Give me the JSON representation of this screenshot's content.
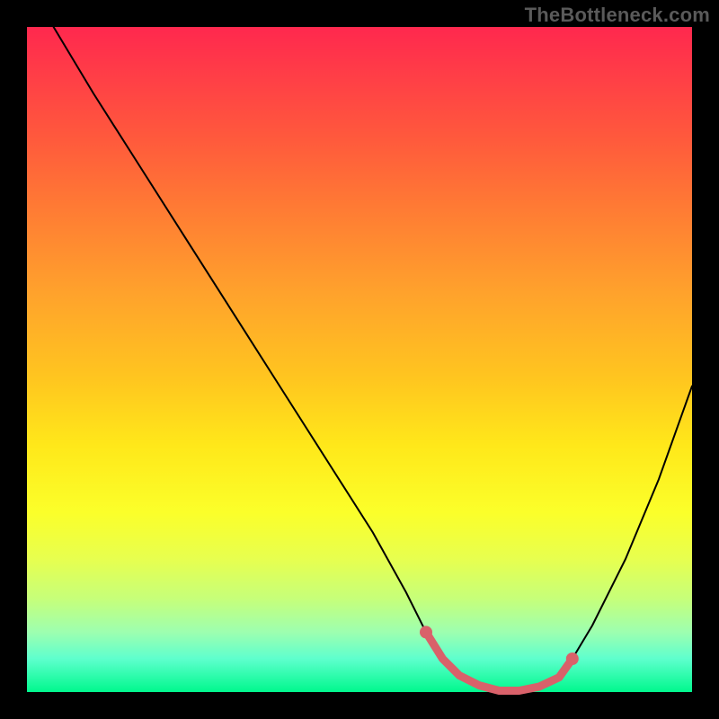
{
  "watermark": "TheBottleneck.com",
  "accent_color": "#d9616a",
  "chart_data": {
    "type": "line",
    "title": "",
    "xlabel": "",
    "ylabel": "",
    "xlim": [
      0,
      100
    ],
    "ylim": [
      0,
      100
    ],
    "grid": false,
    "legend": false,
    "series": [
      {
        "name": "bottleneck-curve",
        "x": [
          4,
          10,
          17,
          24,
          31,
          38,
          45,
          52,
          57,
          60,
          62.5,
          65,
          68,
          71,
          74,
          77,
          80,
          82,
          85,
          90,
          95,
          100
        ],
        "values": [
          100,
          90,
          79,
          68,
          57,
          46,
          35,
          24,
          15,
          9,
          5,
          2.5,
          1,
          0.2,
          0.2,
          0.8,
          2.2,
          5,
          10,
          20,
          32,
          46
        ]
      }
    ],
    "highlight": {
      "x": [
        60,
        62.5,
        65,
        68,
        71,
        74,
        77,
        80,
        82
      ],
      "values": [
        9,
        5,
        2.5,
        1,
        0.2,
        0.2,
        0.8,
        2.2,
        5
      ],
      "endpoints": [
        {
          "x": 60,
          "y": 9
        },
        {
          "x": 82,
          "y": 5
        }
      ]
    }
  }
}
